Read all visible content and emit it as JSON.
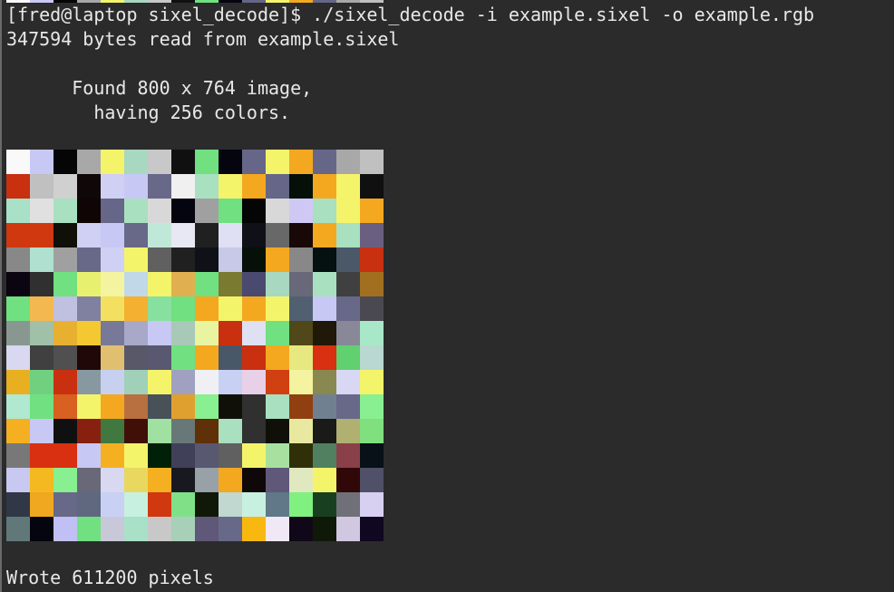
{
  "terminal": {
    "prompt_line": "[fred@laptop sixel_decode]$ ./sixel_decode -i example.sixel -o example.rgb",
    "bytes_line": "347594 bytes read from example.sixel",
    "found_line": "      Found 800 x 764 image,",
    "colors_line": "        having 256 colors.",
    "wrote_line": "Wrote 611200 pixels"
  },
  "image_pixels": [
    [
      "#f9f9f9",
      "#c8c8f4",
      "#050505",
      "#a8a8a8",
      "#f4f46a",
      "#a8d8c0",
      "#c8c8c8",
      "#101010",
      "#70e080",
      "#050510",
      "#666688",
      "#f4f46a",
      "#f4a820",
      "#666688",
      "#a8a8a8",
      "#c0c0c0"
    ],
    [
      "#c83010",
      "#c0c0c0",
      "#d0d0d0",
      "#100808",
      "#d0d0f4",
      "#c8c8f4",
      "#686888",
      "#f0f0f0",
      "#a8e0c0",
      "#f4f46a",
      "#f4a820",
      "#666688",
      "#051008",
      "#f4a820",
      "#f4f46a",
      "#101010"
    ],
    [
      "#a8e0c8",
      "#e0e0e0",
      "#a8e0c0",
      "#100505",
      "#666688",
      "#a8e0c0",
      "#d8d8d8",
      "#050510",
      "#a0a0a0",
      "#70e080",
      "#050505",
      "#d8d8d8",
      "#d0c8f4",
      "#a8e0c0",
      "#f4f46a",
      "#f4a820"
    ],
    [
      "#d03810",
      "#d03810",
      "#101008",
      "#d0d0f4",
      "#c8c8f4",
      "#686888",
      "#c0e8d8",
      "#e8e8f4",
      "#202020",
      "#e0e0f4",
      "#101018",
      "#686868",
      "#180808",
      "#f4a820",
      "#a8e0c0",
      "#6a5f80"
    ],
    [
      "#888888",
      "#b0e0d0",
      "#a0a0a0",
      "#686888",
      "#d0d0f4",
      "#f4f46a",
      "#606060",
      "#202020",
      "#101018",
      "#c8c8e8",
      "#051008",
      "#f4a820",
      "#888888",
      "#051010",
      "#4a5868",
      "#c83010"
    ],
    [
      "#0a0510",
      "#303030",
      "#70e080",
      "#e8f070",
      "#f4f4a0",
      "#c0d8e8",
      "#f4f46a",
      "#e0b050",
      "#70e080",
      "#7a7a30",
      "#4a4a70",
      "#a8d8c0",
      "#686878",
      "#a8e0c0",
      "#404040",
      "#a07020"
    ],
    [
      "#70e080",
      "#f4b850",
      "#c0c0e0",
      "#8080a0",
      "#f4e060",
      "#f4b030",
      "#88e0a0",
      "#70e080",
      "#f4a820",
      "#f4f46a",
      "#f4a820",
      "#f4f46a",
      "#506070",
      "#c8c8f4",
      "#686888",
      "#4a4850"
    ],
    [
      "#889890",
      "#a0c0a8",
      "#e8b030",
      "#f4c830",
      "#787898",
      "#a8a8c8",
      "#c8c8f4",
      "#a8c8b8",
      "#e8f4a0",
      "#c83010",
      "#e0e0f4",
      "#70e080",
      "#504818",
      "#201808",
      "#888898",
      "#a8e8c8"
    ],
    [
      "#d8d8f0",
      "#404040",
      "#505050",
      "#200808",
      "#e0c070",
      "#585868",
      "#585870",
      "#70e080",
      "#f4a820",
      "#485868",
      "#c83010",
      "#f4a820",
      "#e8e880",
      "#d83010",
      "#60d070",
      "#b8d8d0"
    ],
    [
      "#e8b020",
      "#70d080",
      "#c83010",
      "#8898a0",
      "#c8d0f0",
      "#a0d0b8",
      "#f4f46a",
      "#a0a0c0",
      "#f0f0f4",
      "#c8d0f4",
      "#e8d0e8",
      "#d04010",
      "#f4f4a0",
      "#888850",
      "#d8d8f4",
      "#f4f46a"
    ],
    [
      "#b0e8d0",
      "#70e080",
      "#d86020",
      "#f4f46a",
      "#f4a820",
      "#b87040",
      "#485058",
      "#e0a030",
      "#88f090",
      "#101008",
      "#303030",
      "#a8e0c0",
      "#904010",
      "#708090",
      "#686888",
      "#88f090"
    ],
    [
      "#f4b020",
      "#c8c8f4",
      "#101010",
      "#882010",
      "#407840",
      "#401008",
      "#a0e0a0",
      "#687878",
      "#603008",
      "#a8e0c0",
      "#303030",
      "#101008",
      "#e8e8a0",
      "#1a1a18",
      "#b0b070",
      "#80e080"
    ],
    [
      "#787878",
      "#d83010",
      "#d83010",
      "#c8c8f4",
      "#f4b020",
      "#f4f46a",
      "#002008",
      "#404058",
      "#585870",
      "#606060",
      "#f4f46a",
      "#a8e0a0",
      "#303008",
      "#508060",
      "#8a4048",
      "#081018"
    ],
    [
      "#c8c8f0",
      "#f4b820",
      "#88f090",
      "#686878",
      "#d8d8f0",
      "#e8d860",
      "#f4b020",
      "#181820",
      "#98a0a8",
      "#f4a820",
      "#100808",
      "#605878",
      "#e0e8c0",
      "#f4f46a",
      "#300808",
      "#505068"
    ],
    [
      "#303848",
      "#f0a820",
      "#686888",
      "#606880",
      "#c8d0f4",
      "#c8f0e0",
      "#d03810",
      "#80e088",
      "#101808",
      "#c0d8d0",
      "#c8f0e0",
      "#607888",
      "#80f080",
      "#184020",
      "#707078",
      "#d8d0f0"
    ],
    [
      "#607878",
      "#050510",
      "#c0c0f4",
      "#70e080",
      "#c8c8d8",
      "#a8e0c8",
      "#c8c8c8",
      "#a8d0b8",
      "#605878",
      "#686888",
      "#f8b810",
      "#f0e8f4",
      "#100818",
      "#101808",
      "#d0c8e0",
      "#100820"
    ]
  ],
  "top_strip": [
    "#f9f9f9",
    "#c8c8f4",
    "#050505",
    "#a8a8a8",
    "#f4f46a",
    "#a8d8c0",
    "#c8c8c8",
    "#101010",
    "#70e080",
    "#050510",
    "#666688",
    "#f4f46a",
    "#f4a820",
    "#666688",
    "#a8a8a8",
    "#c0c0c0"
  ]
}
